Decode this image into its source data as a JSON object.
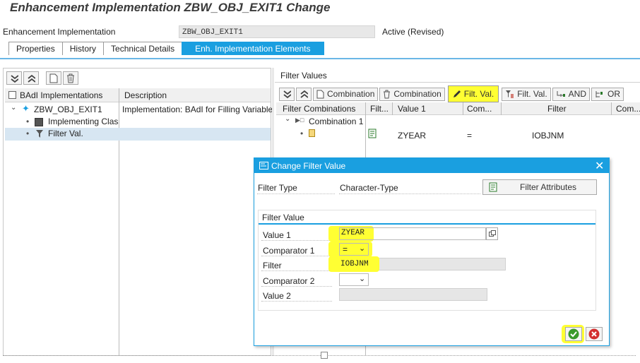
{
  "window": {
    "title": "Enhancement Implementation ZBW_OBJ_EXIT1 Change"
  },
  "header": {
    "impl_label": "Enhancement Implementation",
    "impl_value": "ZBW_OBJ_EXIT1",
    "status": "Active (Revised)"
  },
  "tabs": [
    {
      "label": "Properties"
    },
    {
      "label": "History"
    },
    {
      "label": "Technical Details"
    },
    {
      "label": "Enh. Implementation Elements"
    }
  ],
  "left_panel": {
    "col_badi": "BAdI Implementations",
    "col_desc": "Description",
    "tree": [
      {
        "label": "ZBW_OBJ_EXIT1",
        "description": "Implementation: BAdI for Filling Variable"
      },
      {
        "label": "Implementing Class"
      },
      {
        "label": "Filter Val."
      }
    ]
  },
  "right_panel": {
    "title": "Filter Values",
    "toolbar": {
      "combination_create": "Combination",
      "combination_delete": "Combination",
      "filt_val_change": "Filt. Val.",
      "filt_val_delete": "Filt. Val.",
      "and": "AND",
      "or": "OR"
    },
    "columns": [
      "Filter Combinations",
      "Filt...",
      "Value 1",
      "Com...",
      "Filter",
      "Com..."
    ],
    "rows": [
      {
        "label": "Combination 1"
      },
      {
        "value1": "ZYEAR",
        "comparator": "=",
        "filter": "IOBJNM"
      }
    ]
  },
  "dialog": {
    "title": "Change Filter Value",
    "filter_type_label": "Filter Type",
    "filter_type_value": "Character-Type",
    "filter_attributes_button": "Filter Attributes",
    "group_title": "Filter Value",
    "value1_label": "Value 1",
    "value1": "ZYEAR",
    "comparator1_label": "Comparator 1",
    "comparator1": "=",
    "filter_label": "Filter",
    "filter_value": "IOBJNM",
    "comparator2_label": "Comparator 2",
    "comparator2": "",
    "value2_label": "Value 2",
    "value2": ""
  },
  "colors": {
    "accent": "#1a9fe0",
    "highlight": "#ffff33"
  }
}
